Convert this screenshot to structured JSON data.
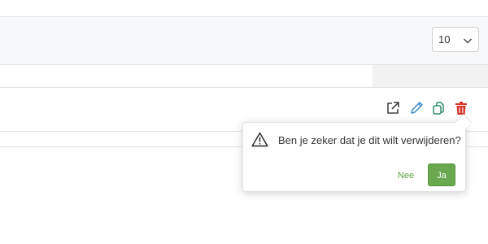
{
  "pagination": {
    "page_size": "10"
  },
  "icons": {
    "page_size_chevron": "chevron-down-icon",
    "open": "external-link-icon",
    "edit": "pencil-icon",
    "copy": "copy-icon",
    "delete": "trash-icon",
    "warning": "warning-triangle-icon"
  },
  "confirm": {
    "message": "Ben je zeker dat je dit wilt verwijderen?",
    "cancel_label": "Nee",
    "confirm_label": "Ja"
  },
  "colors": {
    "edit_icon": "#3a86c8",
    "copy_icon": "#2e8b6e",
    "delete_icon": "#d9342b",
    "confirm_button": "#6aa84f",
    "cancel_text": "#5a9e44"
  }
}
